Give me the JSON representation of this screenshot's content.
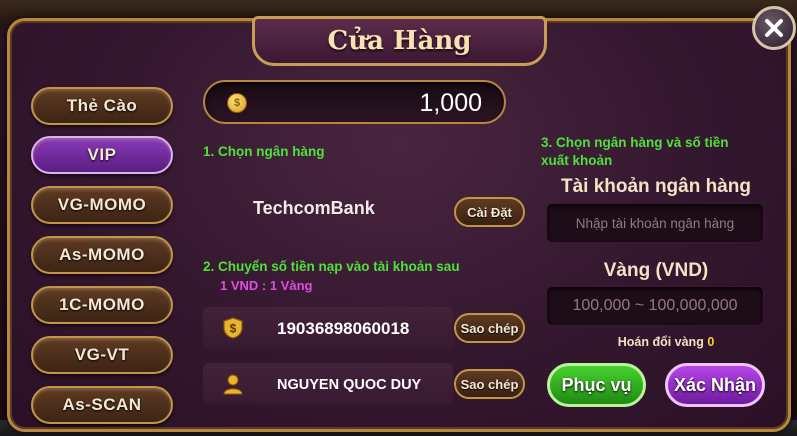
{
  "title": "Cửa Hàng",
  "close_icon": "close-icon",
  "sidebar": {
    "items": [
      {
        "label": "Thẻ Cào"
      },
      {
        "label": "VIP"
      },
      {
        "label": "VG-MOMO"
      },
      {
        "label": "As-MOMO"
      },
      {
        "label": "1C-MOMO"
      },
      {
        "label": "VG-VT"
      },
      {
        "label": "As-SCAN"
      }
    ],
    "active_index": 1
  },
  "balance": {
    "value": "1,000",
    "icon": "coin-icon"
  },
  "step1": {
    "label": "1. Chọn ngân hàng",
    "bank_name": "TechcomBank",
    "install_label": "Cài Đặt"
  },
  "step2": {
    "label": "2. Chuyển số tiền  nạp vào tài khoản sau",
    "rate": "1 VND : 1 Vàng",
    "account_number": "19036898060018",
    "account_name": "NGUYEN QUOC DUY",
    "copy_label": "Sao chép"
  },
  "step3": {
    "label_line1": "3. Chọn ngân hàng và số tiền",
    "label_line2": "xuất khoản",
    "bank_account_title": "Tài khoản ngân hàng",
    "bank_account_placeholder": "Nhập tài khoản ngân hàng",
    "gold_title": "Vàng (VND)",
    "gold_placeholder": "100,000 ~ 100,000,000",
    "exchange_label": "Hoán đổi vàng",
    "exchange_value": "0"
  },
  "buttons": {
    "service": "Phục vụ",
    "confirm": "Xác Nhận"
  },
  "colors": {
    "accent_green": "#4ee13a",
    "accent_magenta": "#e14be0",
    "gold_border": "#c29548",
    "active_purple": "#8a3ab6"
  }
}
